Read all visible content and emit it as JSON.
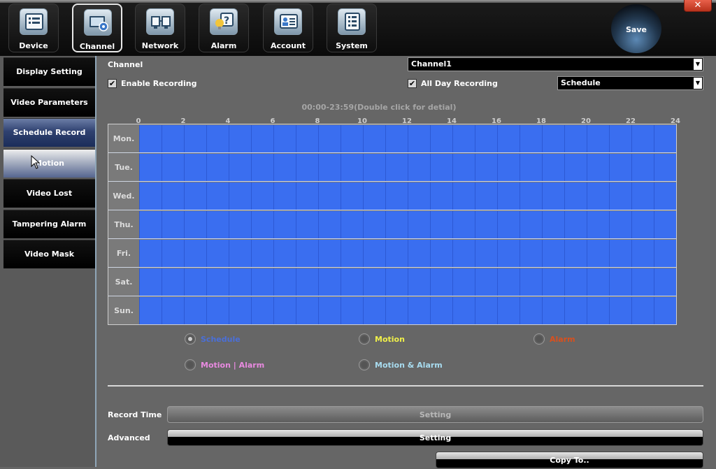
{
  "window": {
    "close_glyph": "✕"
  },
  "nav": {
    "items": [
      {
        "label": "Device",
        "icon": "device-icon"
      },
      {
        "label": "Channel",
        "icon": "channel-icon",
        "active": true
      },
      {
        "label": "Network",
        "icon": "network-icon"
      },
      {
        "label": "Alarm",
        "icon": "alarm-icon"
      },
      {
        "label": "Account",
        "icon": "account-icon"
      },
      {
        "label": "System",
        "icon": "system-icon"
      }
    ],
    "save_label": "Save"
  },
  "sidebar": {
    "items": [
      {
        "label": "Display Setting"
      },
      {
        "label": "Video Parameters"
      },
      {
        "label": "Schedule Record",
        "active": true
      },
      {
        "label": "Motion",
        "sub": true
      },
      {
        "label": "Video Lost"
      },
      {
        "label": "Tampering Alarm"
      },
      {
        "label": "Video Mask"
      }
    ]
  },
  "main": {
    "channel_label": "Channel",
    "channel_value": "Channel1",
    "enable_recording": {
      "label": "Enable Recording",
      "checked": true
    },
    "all_day_recording": {
      "label": "All Day Recording",
      "checked": true
    },
    "record_mode_value": "Schedule",
    "schedule_range": "00:00-23:59(Double click for detial)",
    "hours": [
      "0",
      "2",
      "4",
      "6",
      "8",
      "10",
      "12",
      "14",
      "16",
      "18",
      "20",
      "22",
      "24"
    ],
    "days": [
      "Mon.",
      "Tue.",
      "Wed.",
      "Thu.",
      "Fri.",
      "Sat.",
      "Sun."
    ],
    "schedule_color": "#3a6ef0",
    "legend": [
      {
        "label": "Schedule",
        "color": "#4a6fd8",
        "selected": true
      },
      {
        "label": "Motion",
        "color": "#f0f04a",
        "selected": false
      },
      {
        "label": "Alarm",
        "color": "#d8501e",
        "selected": false
      },
      {
        "label": "Motion | Alarm",
        "color": "#e88ae0",
        "selected": false
      },
      {
        "label": "Motion & Alarm",
        "color": "#a8dcf0",
        "selected": false
      }
    ],
    "record_time_label": "Record Time",
    "record_time_button": "Setting",
    "advanced_label": "Advanced",
    "advanced_button": "Setting",
    "copy_button": "Copy To.."
  }
}
